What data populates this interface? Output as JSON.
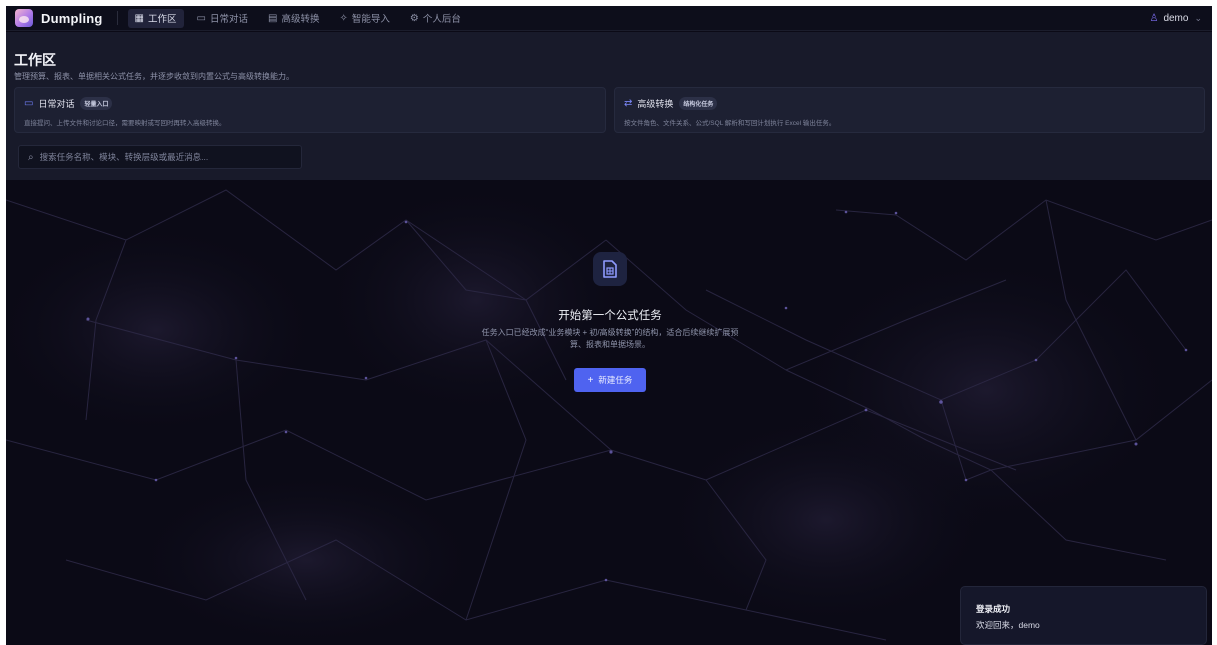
{
  "app": {
    "name": "Dumpling"
  },
  "nav": {
    "tabs": [
      {
        "label": "工作区",
        "icon": "grid-icon",
        "active": true
      },
      {
        "label": "日常对话",
        "icon": "chat-icon",
        "active": false
      },
      {
        "label": "高级转换",
        "icon": "document-icon",
        "active": false
      },
      {
        "label": "智能导入",
        "icon": "sparkle-icon",
        "active": false
      },
      {
        "label": "个人后台",
        "icon": "gear-icon",
        "active": false
      }
    ],
    "user": "demo"
  },
  "header": {
    "title": "工作区",
    "subtitle": "管理预算、报表、单据相关公式任务，并逐步收敛到内置公式与高级转换能力。"
  },
  "cards": [
    {
      "title": "日常对话",
      "badge": "轻量入口",
      "desc": "直接提问、上传文件和讨论口径，需要映射或写回时再转入高级转换。",
      "icon": "chat-icon"
    },
    {
      "title": "高级转换",
      "badge": "结构化任务",
      "desc": "按文件角色、文件关系、公式/SQL 解析和写回计划执行 Excel 输出任务。",
      "icon": "transfer-icon"
    }
  ],
  "search": {
    "placeholder": "搜索任务名称、模块、转换层级或最近消息..."
  },
  "empty_state": {
    "title": "开始第一个公式任务",
    "desc": "任务入口已经改成“业务模块 + 初/高级转换”的结构，适合后续继续扩展预算、报表和单据场景。",
    "button": "新建任务"
  },
  "toast": {
    "title": "登录成功",
    "message": "欢迎回来，demo"
  },
  "colors": {
    "accent": "#4f63f0",
    "background": "#0b0a16",
    "panel": "#181a2a"
  }
}
